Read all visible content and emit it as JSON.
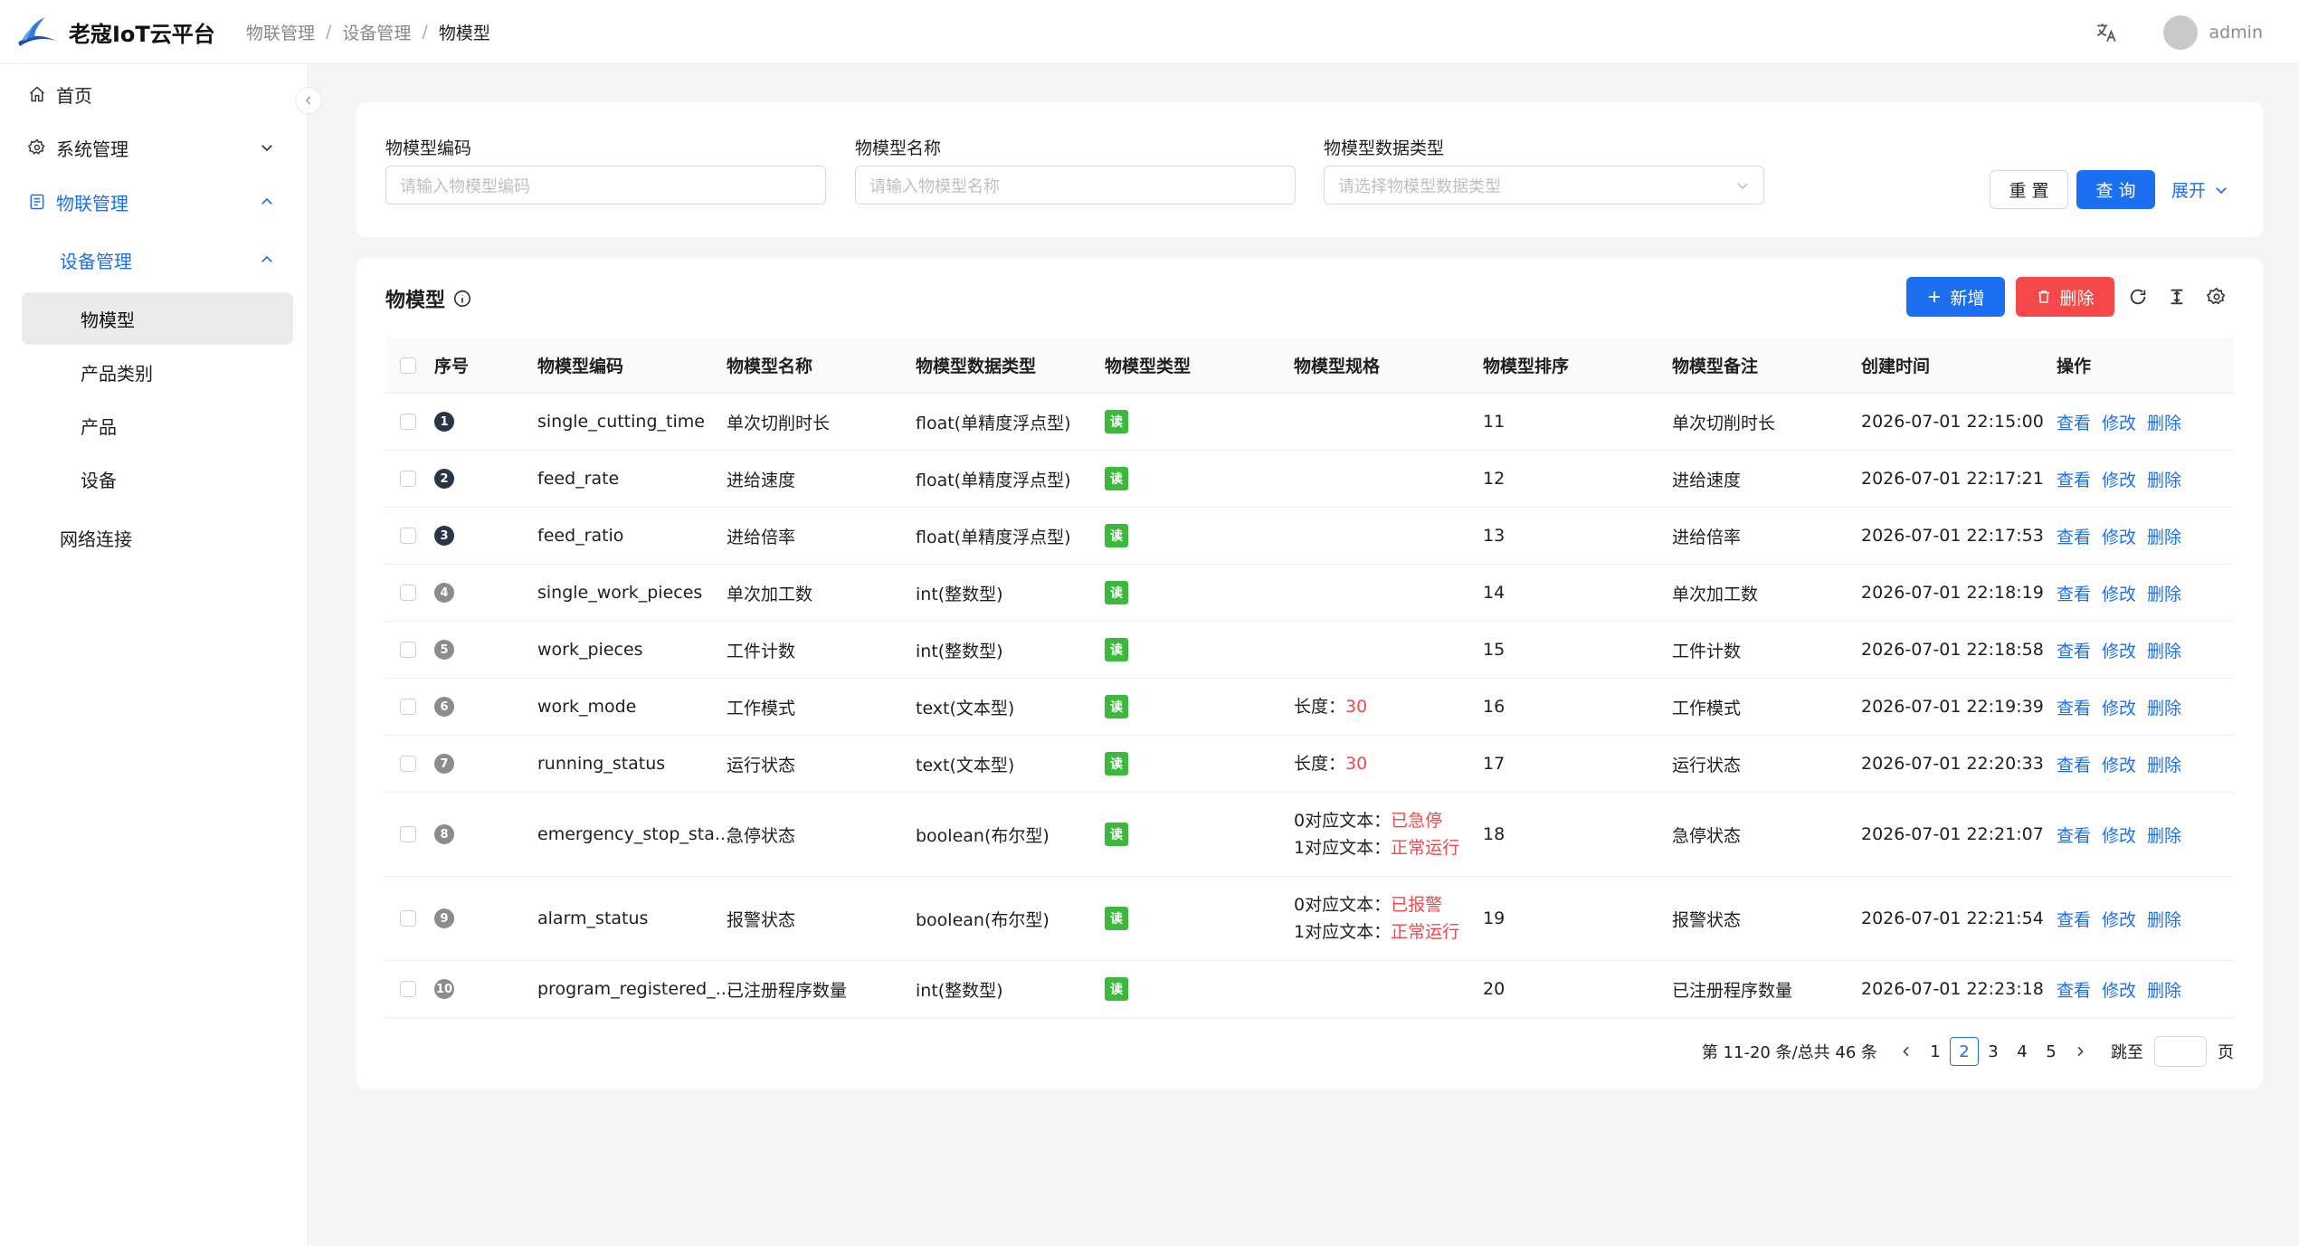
{
  "header": {
    "app_title": "老寇IoT云平台",
    "breadcrumb": [
      "物联管理",
      "设备管理",
      "物模型"
    ],
    "username": "admin"
  },
  "sidebar": {
    "items": [
      {
        "label": "首页",
        "icon": "home-icon"
      },
      {
        "label": "系统管理",
        "icon": "gear-icon"
      },
      {
        "label": "物联管理",
        "icon": "device-icon"
      },
      {
        "label": "设备管理"
      },
      {
        "label": "物模型"
      },
      {
        "label": "产品类别"
      },
      {
        "label": "产品"
      },
      {
        "label": "设备"
      },
      {
        "label": "网络连接"
      }
    ]
  },
  "search": {
    "fields": [
      {
        "label": "物模型编码",
        "placeholder": "请输入物模型编码"
      },
      {
        "label": "物模型名称",
        "placeholder": "请输入物模型名称"
      },
      {
        "label": "物模型数据类型",
        "placeholder": "请选择物模型数据类型"
      }
    ],
    "reset_label": "重 置",
    "query_label": "查 询",
    "expand_label": "展开"
  },
  "table": {
    "title": "物模型",
    "add_label": "新增",
    "delete_label": "删除",
    "columns": [
      "序号",
      "物模型编码",
      "物模型名称",
      "物模型数据类型",
      "物模型类型",
      "物模型规格",
      "物模型排序",
      "物模型备注",
      "创建时间",
      "操作"
    ],
    "ops": [
      "查看",
      "修改",
      "删除"
    ],
    "rows": [
      {
        "index": "1",
        "code": "single_cutting_time",
        "name": "单次切削时长",
        "data_type": "float(单精度浮点型)",
        "type": "读",
        "spec": [],
        "sort": "11",
        "remark": "单次切削时长",
        "created": "2026-07-01 22:15:00"
      },
      {
        "index": "2",
        "code": "feed_rate",
        "name": "进给速度",
        "data_type": "float(单精度浮点型)",
        "type": "读",
        "spec": [],
        "sort": "12",
        "remark": "进给速度",
        "created": "2026-07-01 22:17:21"
      },
      {
        "index": "3",
        "code": "feed_ratio",
        "name": "进给倍率",
        "data_type": "float(单精度浮点型)",
        "type": "读",
        "spec": [],
        "sort": "13",
        "remark": "进给倍率",
        "created": "2026-07-01 22:17:53"
      },
      {
        "index": "4",
        "code": "single_work_pieces",
        "name": "单次加工数",
        "data_type": "int(整数型)",
        "type": "读",
        "spec": [],
        "sort": "14",
        "remark": "单次加工数",
        "created": "2026-07-01 22:18:19"
      },
      {
        "index": "5",
        "code": "work_pieces",
        "name": "工件计数",
        "data_type": "int(整数型)",
        "type": "读",
        "spec": [],
        "sort": "15",
        "remark": "工件计数",
        "created": "2026-07-01 22:18:58"
      },
      {
        "index": "6",
        "code": "work_mode",
        "name": "工作模式",
        "data_type": "text(文本型)",
        "type": "读",
        "spec": [
          {
            "label": "长度：",
            "value": "30"
          }
        ],
        "sort": "16",
        "remark": "工作模式",
        "created": "2026-07-01 22:19:39"
      },
      {
        "index": "7",
        "code": "running_status",
        "name": "运行状态",
        "data_type": "text(文本型)",
        "type": "读",
        "spec": [
          {
            "label": "长度：",
            "value": "30"
          }
        ],
        "sort": "17",
        "remark": "运行状态",
        "created": "2026-07-01 22:20:33"
      },
      {
        "index": "8",
        "code": "emergency_stop_sta...",
        "name": "急停状态",
        "data_type": "boolean(布尔型)",
        "type": "读",
        "spec": [
          {
            "label": "0对应文本：",
            "value": "已急停"
          },
          {
            "label": "1对应文本：",
            "value": "正常运行"
          }
        ],
        "sort": "18",
        "remark": "急停状态",
        "created": "2026-07-01 22:21:07"
      },
      {
        "index": "9",
        "code": "alarm_status",
        "name": "报警状态",
        "data_type": "boolean(布尔型)",
        "type": "读",
        "spec": [
          {
            "label": "0对应文本：",
            "value": "已报警"
          },
          {
            "label": "1对应文本：",
            "value": "正常运行"
          }
        ],
        "sort": "19",
        "remark": "报警状态",
        "created": "2026-07-01 22:21:54"
      },
      {
        "index": "10",
        "code": "program_registered_...",
        "name": "已注册程序数量",
        "data_type": "int(整数型)",
        "type": "读",
        "spec": [],
        "sort": "20",
        "remark": "已注册程序数量",
        "created": "2026-07-01 22:23:18"
      }
    ]
  },
  "pagination": {
    "summary": "第 11-20 条/总共 46 条",
    "pages": [
      "1",
      "2",
      "3",
      "4",
      "5"
    ],
    "current": "2",
    "goto_label": "跳至",
    "page_suffix": "页"
  },
  "colors": {
    "primary": "#1d6ff2",
    "danger": "#f5484a",
    "tag_green": "#3cb93c",
    "spec_red": "#f2474c"
  }
}
